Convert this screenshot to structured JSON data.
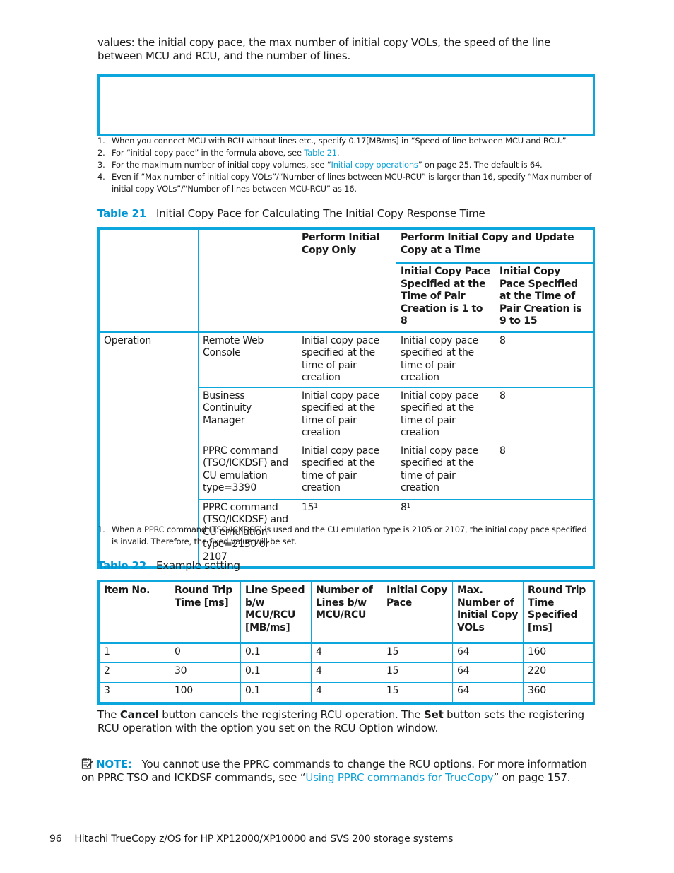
{
  "intro_text": "values: the initial copy pace, the max number of initial copy VOLs, the speed of the line between MCU and RCU, and the number of lines.",
  "footnotes_top": [
    {
      "num": "1.",
      "text": "When you connect MCU with RCU without lines etc., specify 0.17[MB/ms] in “Speed of line between MCU and RCU.”"
    },
    {
      "num": "2.",
      "pre": "For “initial copy pace” in the formula above, see ",
      "link": "Table 21",
      "post": "."
    },
    {
      "num": "3.",
      "pre": "For the maximum number of initial copy volumes, see “",
      "link": "Initial copy operations",
      "post": "” on page 25. The default is 64."
    },
    {
      "num": "4.",
      "text": "Even if “Max number of initial copy VOLs”/“Number of lines between MCU-RCU” is larger than 16, specify “Max number of initial copy VOLs”/“Number of lines between MCU-RCU” as 16."
    }
  ],
  "table21": {
    "label": "Table 21",
    "title": "Initial Copy Pace for Calculating The Initial Copy Response Time",
    "header": {
      "col3": "Perform Initial Copy Only",
      "col45": "Perform Initial Copy and Update Copy at a Time",
      "col4": "Initial Copy Pace Specified at the Time of Pair Creation is 1 to 8",
      "col5": "Initial Copy Pace Specified at the Time of Pair Creation is 9 to 15"
    },
    "group_label": "Operation",
    "rows": [
      {
        "method": "Remote Web Console",
        "initial_only": "Initial copy pace specified at the time of pair creation",
        "pace_1_8": "Initial copy pace specified at the time of pair creation",
        "pace_9_15": "8"
      },
      {
        "method": "Business Continuity Manager",
        "initial_only": "Initial copy pace specified at the time of pair creation",
        "pace_1_8": "Initial copy pace specified at the time of pair creation",
        "pace_9_15": "8"
      },
      {
        "method": "PPRC command (TSO/ICKDSF) and CU emulation type=3390",
        "initial_only": "Initial copy pace specified at the time of pair creation",
        "pace_1_8": "Initial copy pace specified at the time of pair creation",
        "pace_9_15": "8"
      },
      {
        "method": "PPRC command (TSO/ICKDSF) and CU emulation type=2150 or 2107",
        "initial_only": "15",
        "initial_only_sup": "1",
        "merged": "8",
        "merged_sup": "1"
      }
    ],
    "footnote": {
      "num": "1.",
      "text": "When a PPRC command (TSO/ICKDSF) is used and the CU emulation type is 2105 or 2107, the initial copy pace specified is invalid. Therefore, the fixed value will be set."
    }
  },
  "table22": {
    "label": "Table 22",
    "title": "Example setting",
    "columns": [
      "Item No.",
      "Round Trip Time [ms]",
      "Line Speed b/w MCU/RCU [MB/ms]",
      "Number of Lines b/w MCU/RCU",
      "Initial Copy Pace",
      "Max. Number of Initial Copy VOLs",
      "Round Trip Time Specified [ms]"
    ],
    "rows": [
      [
        "1",
        "0",
        "0.1",
        "4",
        "15",
        "64",
        "160"
      ],
      [
        "2",
        "30",
        "0.1",
        "4",
        "15",
        "64",
        "220"
      ],
      [
        "3",
        "100",
        "0.1",
        "4",
        "15",
        "64",
        "360"
      ]
    ]
  },
  "buttons_text": {
    "p1": "The ",
    "cancel": "Cancel",
    "p2": " button cancels the registering RCU operation. The ",
    "set": "Set",
    "p3": " button sets the registering RCU operation with the option you set on the RCU Option window."
  },
  "note": {
    "icon": "note-pad-icon",
    "label": "NOTE:",
    "pre": "You cannot use the PPRC commands to change the RCU options. For more information on PPRC TSO and ICKDSF commands, see “",
    "link": "Using PPRC commands for TrueCopy",
    "post": "” on page 157."
  },
  "footer": {
    "page_number": "96",
    "title": "Hitachi TrueCopy z/OS for HP XP12000/XP10000 and SVS 200 storage systems"
  },
  "colors": {
    "accent": "#0096d6",
    "rule": "#0aa6dc",
    "link": "#0aa2d9"
  }
}
